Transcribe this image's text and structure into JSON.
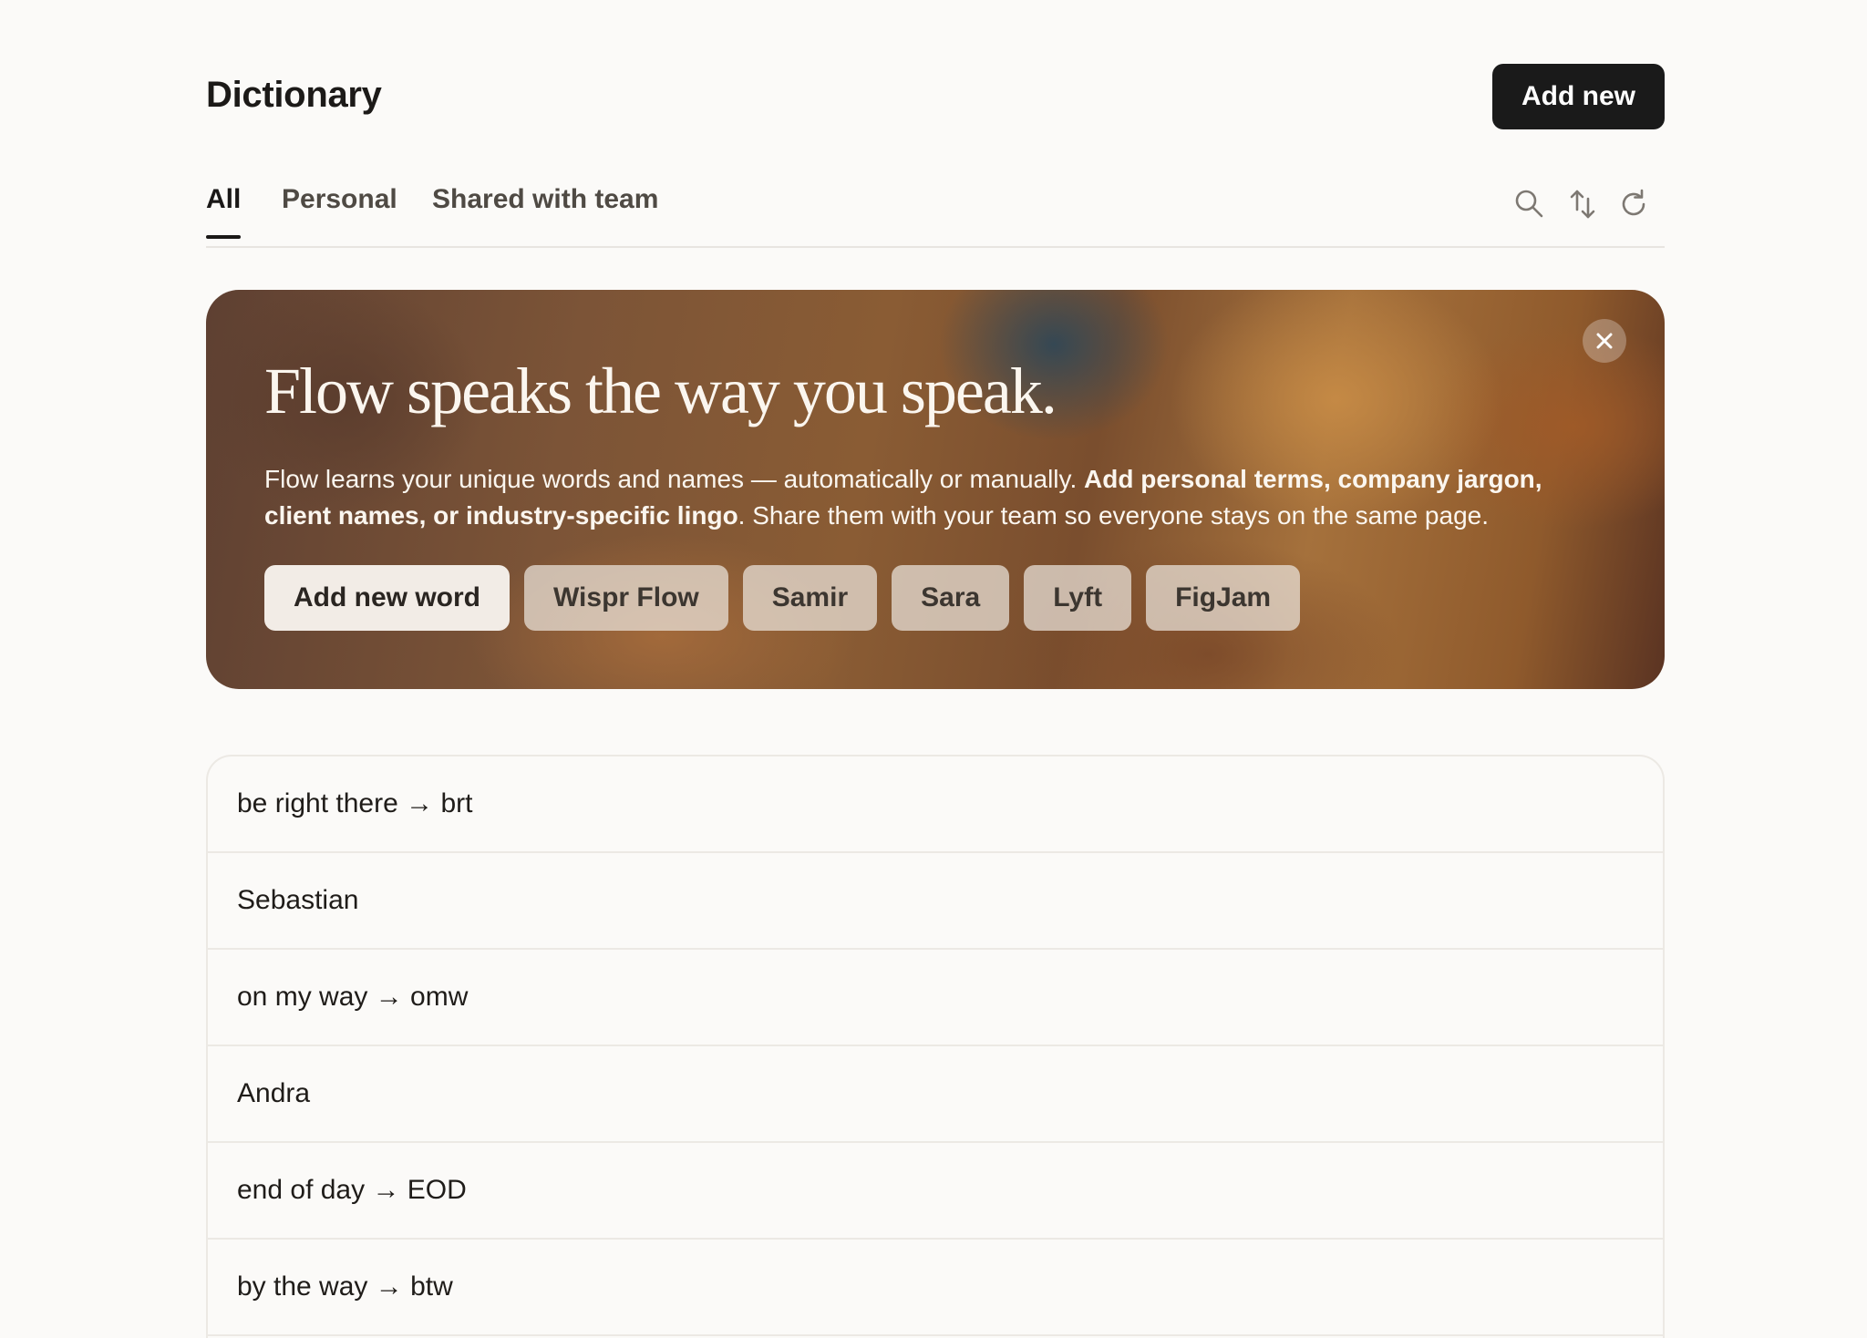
{
  "header": {
    "title": "Dictionary",
    "add_new_label": "Add new"
  },
  "tabs": [
    {
      "label": "All",
      "active": true
    },
    {
      "label": "Personal",
      "active": false
    },
    {
      "label": "Shared with team",
      "active": false
    }
  ],
  "toolbar": {
    "icons": [
      "search-icon",
      "sort-icon",
      "refresh-icon"
    ]
  },
  "banner": {
    "headline": "Flow speaks the way you speak.",
    "text_part1": "Flow learns your unique words and names — automatically or manually. ",
    "text_bold": "Add personal terms, company jargon, client names, or industry-specific lingo",
    "text_part2": ". Share them with your team so everyone stays on the same page.",
    "close_icon": "close-icon",
    "chips": [
      "Add new word",
      "Wispr Flow",
      "Samir",
      "Sara",
      "Lyft",
      "FigJam"
    ]
  },
  "entries": [
    "be right there → brt",
    "Sebastian",
    "on my way → omw",
    "Andra",
    "end of day → EOD",
    "by the way → btw"
  ]
}
